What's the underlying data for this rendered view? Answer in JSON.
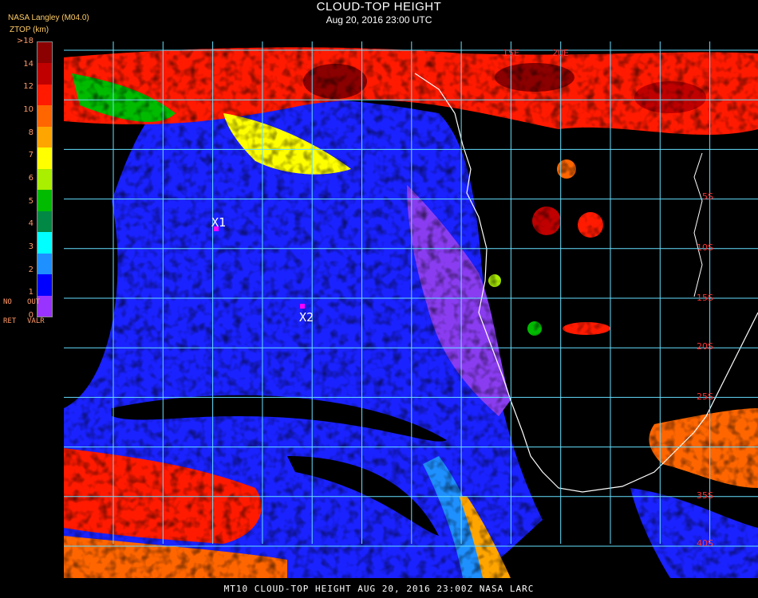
{
  "header": {
    "title": "CLOUD-TOP HEIGHT",
    "subtitle": "Aug 20, 2016 23:00 UTC",
    "source": "NASA Langley (M04.0)",
    "units": "ZTOP (km)"
  },
  "legend": {
    "ticks": [
      ">18",
      "14",
      "12",
      "10",
      "8",
      "7",
      "6",
      "5",
      "4",
      "3",
      "2",
      "1",
      "0"
    ],
    "colors": [
      "#8b0000",
      "#c00000",
      "#ff1a00",
      "#ff6600",
      "#ffa500",
      "#ffff00",
      "#aaee00",
      "#00bb00",
      "#008844",
      "#00ffff",
      "#1e90ff",
      "#0000ff",
      "#9933ff"
    ],
    "note_line1_a": "NO",
    "note_line1_b": "OUT",
    "note_line2_a": "RET",
    "note_line2_b": "VALR"
  },
  "map": {
    "grid_color": "#66e0ff",
    "lat_labels": [
      "5S",
      "10S",
      "15S",
      "20S",
      "25S",
      "35S",
      "40S"
    ],
    "lon_labels": [
      "15E",
      "20E"
    ],
    "markers": [
      {
        "label": "X1",
        "color": "#ff00ff"
      },
      {
        "label": "X2",
        "color": "#ff00ff"
      }
    ]
  },
  "footer": {
    "text": "MT10  CLOUD-TOP HEIGHT   AUG 20, 2016 23:00Z   NASA LARC"
  }
}
